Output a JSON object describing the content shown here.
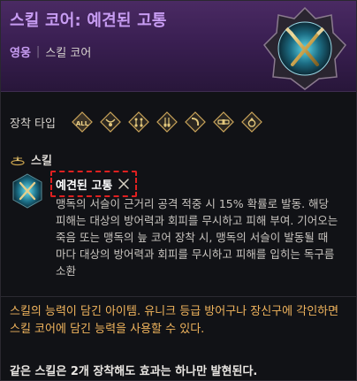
{
  "header": {
    "title": "스킬 코어: 예견된 고통",
    "grade": "영웅",
    "separator": "|",
    "item_type": "스킬 코어"
  },
  "equip": {
    "label": "장착 타입",
    "slots": [
      {
        "name": "all",
        "text": "ALL"
      },
      {
        "name": "necklace"
      },
      {
        "name": "earring-1"
      },
      {
        "name": "earring-2"
      },
      {
        "name": "bracelet"
      },
      {
        "name": "belt"
      },
      {
        "name": "ring"
      }
    ]
  },
  "skill": {
    "section_label": "스킬",
    "name": "예견된 고통",
    "description": "맹독의 서슬이 근거리 공격 적중 시 15% 확률로 발동. 해당 피해는 대상의 방어력과 회피를 무시하고 피해 부여. 기어오는 죽음 또는 맹독의 늪 코어 장착 시, 맹독의 서슬이 발동될 때 마다 대상의 방어력과 회피를 무시하고 피해를 입히는 독구름 소환"
  },
  "info": {
    "text": "스킬의 능력이 담긴 아이템. 유니크 등급 방어구나 장신구에 각인하면 스킬 코어에 담긴 능력을 사용할 수 있다."
  },
  "note": {
    "text": "같은 스킬은 2개 장착해도 효과는 하나만 발현된다."
  },
  "colors": {
    "grade_purple": "#c79cf2",
    "highlight_red": "#e02020",
    "info_orange": "#f0b45d"
  },
  "icons": {
    "hero": "crossed-daggers-emblem-icon",
    "skill": "crossed-daggers-icon",
    "inline_skill": "crossed-swords-icon",
    "section": "skill-section-icon"
  }
}
